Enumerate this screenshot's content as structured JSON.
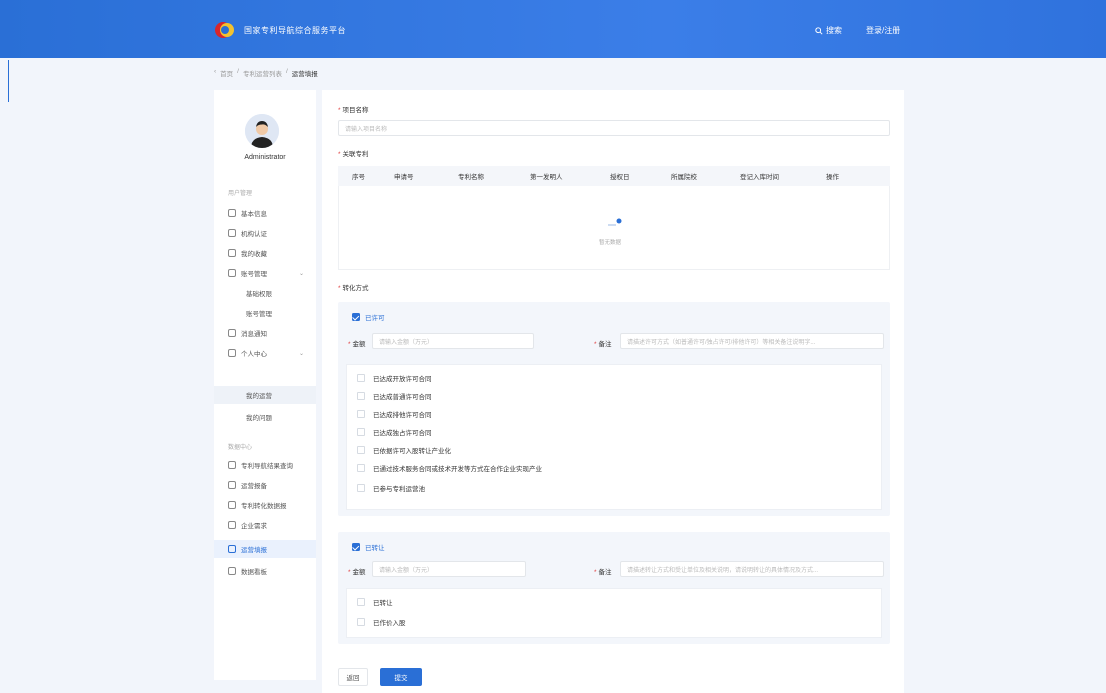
{
  "header": {
    "site_name": "国家专利导航综合服务平台",
    "search_label": "搜索",
    "login_label": "登录/注册",
    "brand_color": "#2a6fd6"
  },
  "breadcrumb": [
    "首页",
    "专利运营列表",
    "运营填报"
  ],
  "sidebar": {
    "username": "Administrator",
    "section1_title": "用户管理",
    "section1_items": [
      {
        "label": "基本信息",
        "icon": "home-icon"
      },
      {
        "label": "机构认证",
        "icon": "id-card-icon"
      },
      {
        "label": "我的收藏",
        "icon": "star-icon"
      },
      {
        "label": "账号管理",
        "icon": "chat-icon",
        "expandable": true
      },
      {
        "label": "基础权限",
        "sub": true
      },
      {
        "label": "账号管理",
        "sub": true
      },
      {
        "label": "消息通知",
        "icon": "bell-icon"
      },
      {
        "label": "个人中心",
        "icon": "settings-icon",
        "expandable": true
      },
      {
        "label": "我的运营",
        "sub": true,
        "selected": true
      },
      {
        "label": "我的问题",
        "sub": true
      }
    ],
    "section2_title": "数据中心",
    "section2_items": [
      {
        "label": "专利导航结果查询",
        "icon": "search-list-icon"
      },
      {
        "label": "运营报备",
        "icon": "report-icon"
      },
      {
        "label": "专利转化数据报",
        "icon": "data-icon"
      },
      {
        "label": "企业需求",
        "icon": "demand-icon"
      },
      {
        "label": "运营填报",
        "icon": "edit-icon",
        "active": true
      },
      {
        "label": "数据看板",
        "icon": "dashboard-icon"
      }
    ]
  },
  "form": {
    "project_label": "项目名称",
    "project_placeholder": "请输入项目名称",
    "patent_label": "关联专利",
    "table_headers": [
      "序号",
      "申请号",
      "专利名称",
      "第一发明人",
      "授权日",
      "所属院校",
      "登记入库时间",
      "操作"
    ],
    "empty_text": "暂无数据",
    "method_label": "转化方式",
    "card1": {
      "title": "已许可",
      "amount_label": "金额",
      "amount_placeholder": "请输入金额（万元）",
      "note_label": "备注",
      "note_placeholder": "请描述许可方式（如普通许可/独占许可/排他许可）等相关备注说明字...",
      "options": [
        "已达成开放许可合同",
        "已达成普通许可合同",
        "已达成排他许可合同",
        "已达成独占许可合同",
        "已依据许可入股转让产业化",
        "已通过技术服务合同或技术开发等方式在合作企业实现产业",
        "已参与专利运营池"
      ]
    },
    "card2": {
      "title": "已转让",
      "amount_label": "金额",
      "amount_placeholder": "请输入金额（万元）",
      "note_label": "备注",
      "note_placeholder": "请描述转让方式和受让单位及相关说明，请说明转让的具体情况及方式...",
      "options": [
        "已转让",
        "已作价入股"
      ]
    },
    "cancel_label": "返回",
    "submit_label": "提交"
  }
}
